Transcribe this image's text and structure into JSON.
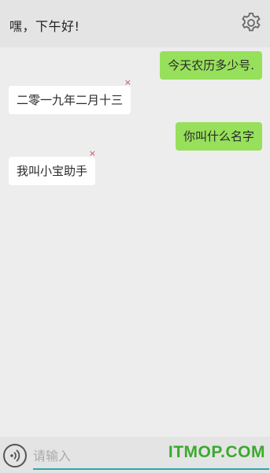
{
  "header": {
    "greeting": "嘿，下午好!",
    "settings_icon": "gear-icon"
  },
  "messages": [
    {
      "from": "user",
      "text": "今天农历多少号."
    },
    {
      "from": "bot",
      "text": "二零一九年二月十三",
      "close": "×"
    },
    {
      "from": "user",
      "text": "你叫什么名字"
    },
    {
      "from": "bot",
      "text": "我叫小宝助手",
      "close": "×"
    }
  ],
  "input": {
    "placeholder": "请输入",
    "value": "",
    "voice_icon": "voice-icon"
  },
  "watermark": "ITMOP.COM",
  "colors": {
    "user_bubble": "#97e05b",
    "bot_bubble": "#ffffff",
    "input_underline": "#2aa8b3",
    "close_x": "#e0475a",
    "watermark": "#3aaa2e"
  }
}
